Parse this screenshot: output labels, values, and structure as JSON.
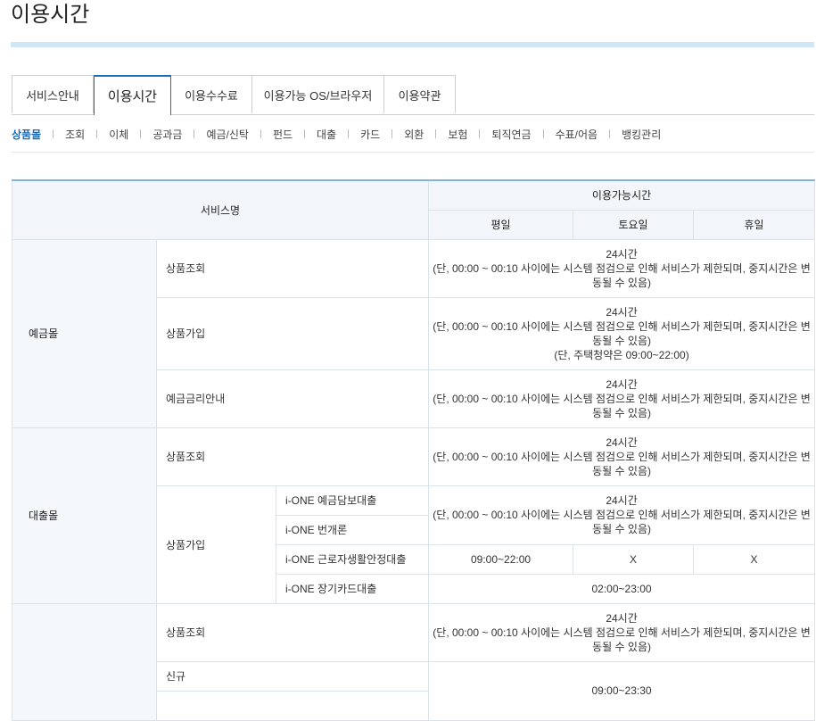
{
  "page": {
    "title": "이용시간"
  },
  "tabs": [
    {
      "label": "서비스안내",
      "active": false
    },
    {
      "label": "이용시간",
      "active": true
    },
    {
      "label": "이용수수료",
      "active": false
    },
    {
      "label": "이용가능 OS/브라우저",
      "active": false
    },
    {
      "label": "이용약관",
      "active": false
    }
  ],
  "subnav": [
    "상품몰",
    "조회",
    "이체",
    "공과금",
    "예금/신탁",
    "펀드",
    "대출",
    "카드",
    "외환",
    "보험",
    "퇴직연금",
    "수표/어음",
    "뱅킹관리"
  ],
  "table": {
    "headers": {
      "service": "서비스명",
      "available": "이용가능시간",
      "weekday": "평일",
      "saturday": "토요일",
      "holiday": "휴일"
    },
    "time24": "24시간",
    "note": "(단, 00:00 ~ 00:10 사이에는 시스템 점검으로 인해 서비스가 제한되며, 중지시간은 변동될 수 있음)",
    "housing_note": "(단, 주택청약은 09:00~22:00)",
    "groups": {
      "deposit": "예금몰",
      "loan": "대출몰"
    },
    "rows": {
      "inquiry": "상품조회",
      "join": "상품가입",
      "rate_info": "예금금리안내",
      "new": "신규"
    },
    "loan_products": [
      "i-ONE 예금담보대출",
      "i-ONE 번개론",
      "i-ONE 근로자생활안정대출",
      "i-ONE 장기카드대출"
    ],
    "worker_loan": {
      "weekday": "09:00~22:00",
      "saturday": "X",
      "holiday": "X"
    },
    "card_loan_time": "02:00~23:00",
    "new_time": "09:00~23:30"
  }
}
